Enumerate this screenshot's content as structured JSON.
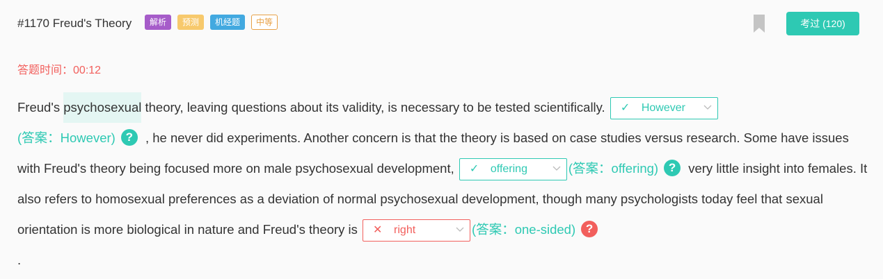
{
  "question": {
    "title": "#1170 Freud's Theory",
    "tags": [
      "解析",
      "预测",
      "机经题",
      "中等"
    ],
    "pass_button": "考过 (120)",
    "timer_label": "答题时间：",
    "timer_value": "00:12"
  },
  "passage": {
    "p1": "Freud's ",
    "highlight": "psychosexual",
    "p2": " theory, leaving questions about its validity, is necessary to be tested scientifically.",
    "p3": " , he never did experiments. Another concern is that the theory is based on case studies versus research. Some have issues with Freud's theory being focused more on male psychosexual development,",
    "p4": " very little insight into females. It also refers to homosexual preferences as a deviation of normal psychosexual development, though many psychologists today feel that sexual orientation is more biological in nature and Freud's theory is",
    "p5": " ."
  },
  "blanks": [
    {
      "mark": "✓",
      "selected": "However",
      "answer": "(答案：However)",
      "help": "?",
      "status": "correct"
    },
    {
      "mark": "✓",
      "selected": "offering",
      "answer": "(答案：offering)",
      "help": "?",
      "status": "correct"
    },
    {
      "mark": "✕",
      "selected": "right",
      "answer": "(答案：one-sided)",
      "help": "?",
      "status": "incorrect"
    }
  ],
  "colors": {
    "accent": "#2ec9b3",
    "error": "#f25f5c"
  },
  "icons": {
    "bookmark": "bookmark-icon",
    "check": "check-icon",
    "cross": "cross-icon",
    "chevron": "chevron-down-icon",
    "help": "help-icon"
  }
}
